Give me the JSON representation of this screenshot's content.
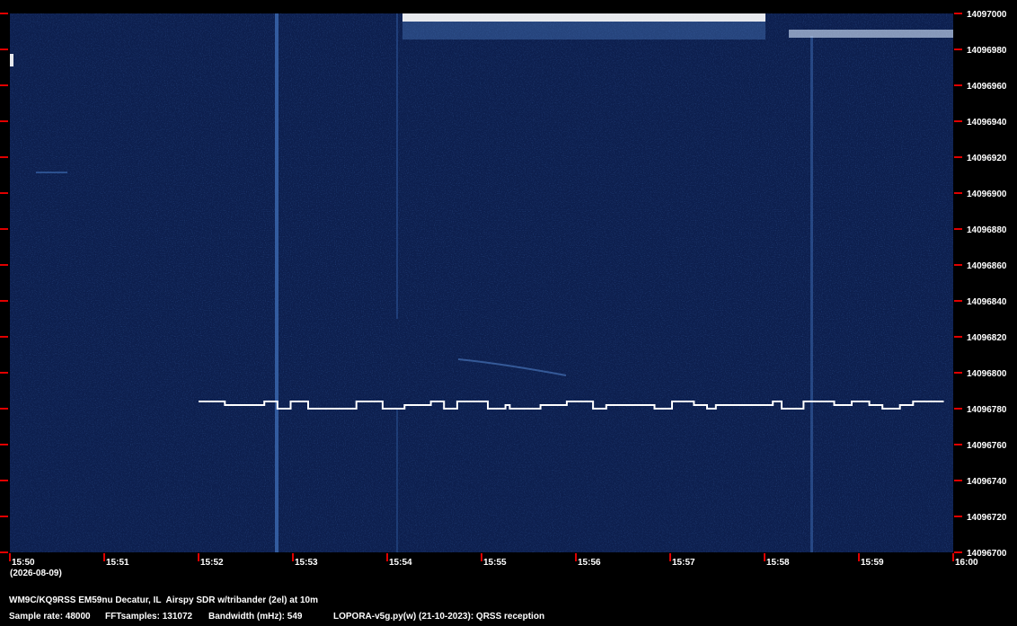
{
  "chart_data": {
    "type": "heatmap",
    "title": "",
    "xlabel": "",
    "ylabel": "",
    "date_label": "(2026-08-09)",
    "x_ticks": [
      "15:50",
      "15:51",
      "15:52",
      "15:53",
      "15:54",
      "15:55",
      "15:56",
      "15:57",
      "15:58",
      "15:59",
      "16:00"
    ],
    "y_ticks": [
      14097000,
      14096980,
      14096960,
      14096940,
      14096920,
      14096900,
      14096880,
      14096860,
      14096840,
      14096820,
      14096800,
      14096780,
      14096760,
      14096740,
      14096720,
      14096700
    ],
    "xlim_minutes": [
      0,
      10
    ],
    "ylim_hz": [
      14096700,
      14097000
    ],
    "fsk_trace": {
      "start_minute": 2.0,
      "end_minute": 9.9,
      "freq_low_hz": 14096780,
      "freq_high_hz": 14096784,
      "freq_mid_hz": 14096782,
      "symbols": "HHHHHHMMMMMMMMMHHHLLLHHHHLLLLLLLLLLLHHHHHHLLLLLMMMMMMHHHLLLHHHHHHHLLLLMLLLLLLLMMMMMMHHHHHHLLLMMMMMMMMMMMLLLLHHHHHMMMLLMMMMMMMMMMMMMHHLLLLLHHHHHHHMMMMHHHHMMMLLLLMMMHHHHHHH"
    },
    "colors": {
      "background": "#0d1f4e",
      "signal": "#ffffff",
      "tick": "#e00000"
    }
  },
  "footer": {
    "station": "WM9C/KQ9RSS EM59nu Decatur, IL  Airspy SDR w/tribander (2el) at 10m",
    "sample_rate": "Sample rate: 48000",
    "fft_samples": "FFTsamples: 131072",
    "bandwidth": "Bandwidth (mHz): 549",
    "software": "LOPORA-v5g.py(w) (21-10-2023): QRSS reception"
  }
}
